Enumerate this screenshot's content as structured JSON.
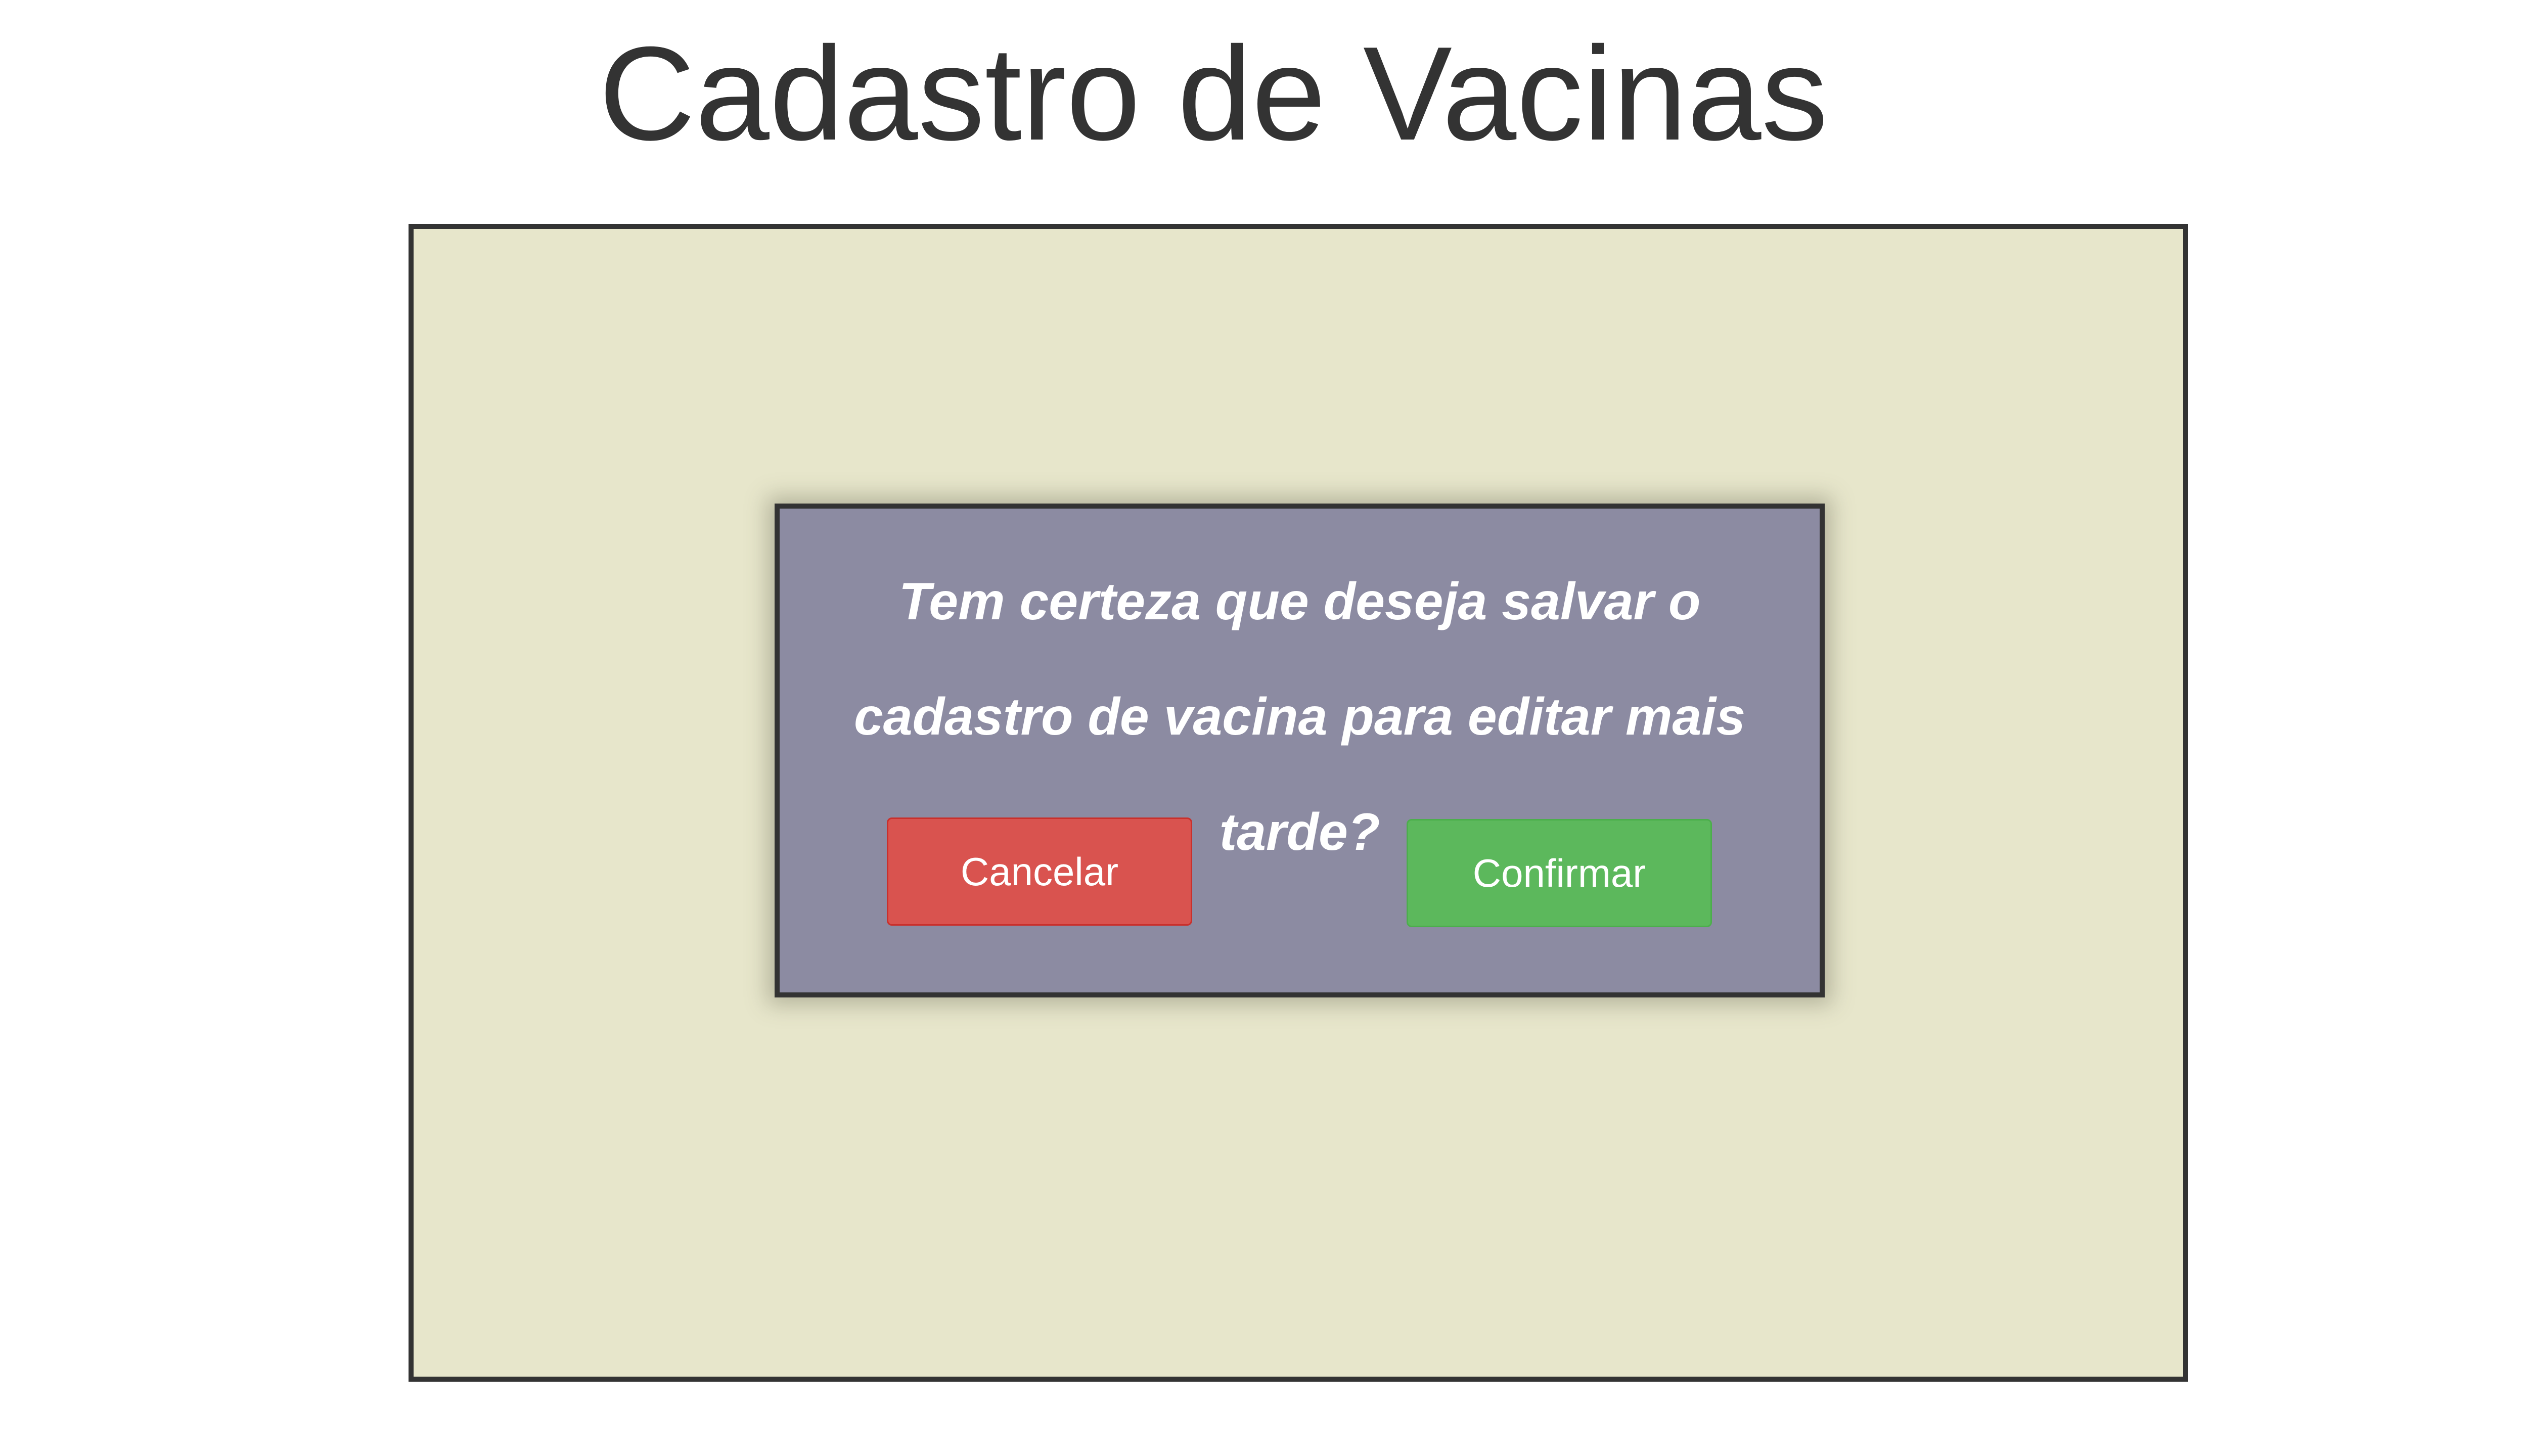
{
  "page": {
    "title": "Cadastro de Vacinas"
  },
  "dialog": {
    "message": "Tem certeza que deseja salvar o cadastro de vacina para editar mais tarde?",
    "cancel_label": "Cancelar",
    "confirm_label": "Confirmar"
  },
  "colors": {
    "panel_background": "#e7e6cb",
    "dialog_background": "#8c8ba2",
    "cancel_button": "#d9534f",
    "confirm_button": "#5cb85c",
    "border": "#333333"
  }
}
